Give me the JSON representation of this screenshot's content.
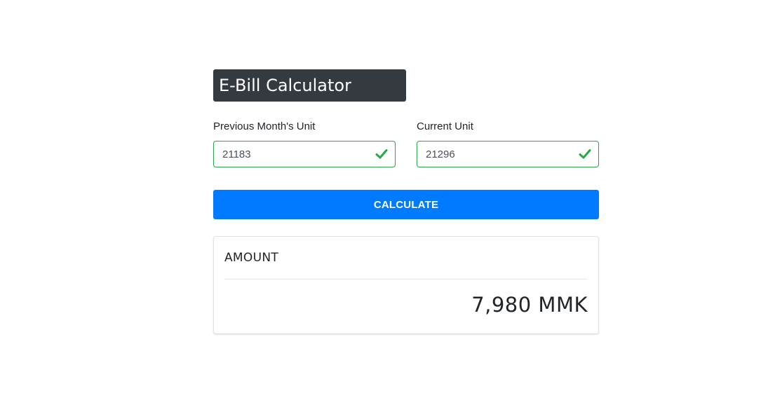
{
  "header": {
    "title": "E-Bill Calculator"
  },
  "form": {
    "previous_unit": {
      "label": "Previous Month's Unit",
      "value": "21183",
      "status_icon": "check-icon",
      "status_color": "#28a745"
    },
    "current_unit": {
      "label": "Current Unit",
      "value": "21296",
      "status_icon": "check-icon",
      "status_color": "#28a745"
    },
    "calculate_label": "CALCULATE"
  },
  "result": {
    "heading": "AMOUNT",
    "value": "7,980 MMK"
  },
  "colors": {
    "title_background": "#343a40",
    "button_primary": "#007bff",
    "valid_border": "#28a745"
  }
}
